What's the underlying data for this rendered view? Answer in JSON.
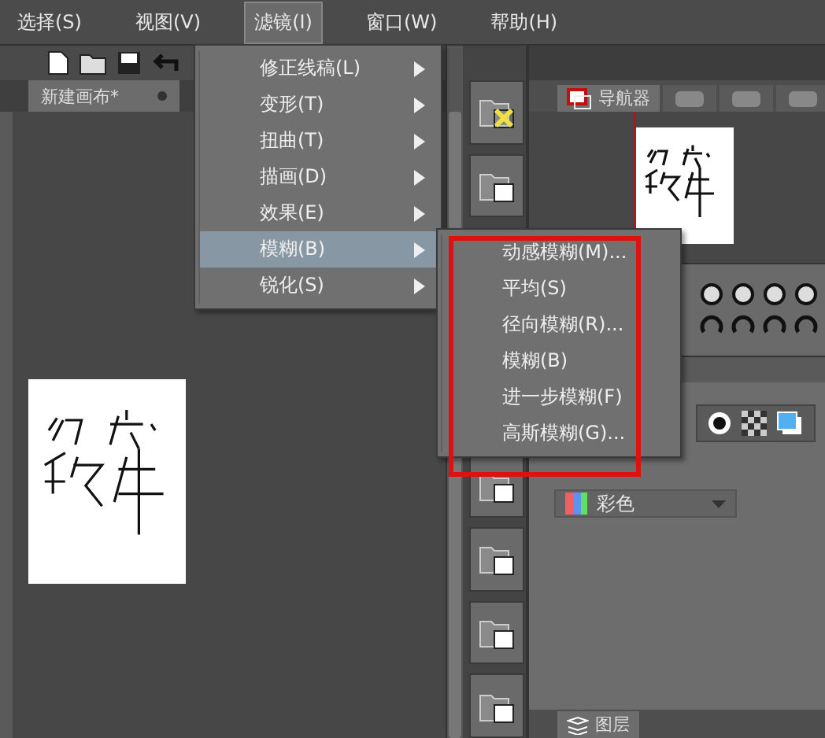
{
  "menu_bar": [
    {
      "label": "选择(S)",
      "selected": false
    },
    {
      "label": "视图(V)",
      "selected": false
    },
    {
      "label": "滤镜(I)",
      "selected": true
    },
    {
      "label": "窗口(W)",
      "selected": false
    },
    {
      "label": "帮助(H)",
      "selected": false
    }
  ],
  "document_tab": {
    "title": "新建画布*"
  },
  "filter_menu": {
    "items": [
      {
        "label": "修正线稿(L)",
        "selected": false
      },
      {
        "label": "变形(T)",
        "selected": false
      },
      {
        "label": "扭曲(T)",
        "selected": false
      },
      {
        "label": "描画(D)",
        "selected": false
      },
      {
        "label": "效果(E)",
        "selected": false
      },
      {
        "label": "模糊(B)",
        "selected": true
      },
      {
        "label": "锐化(S)",
        "selected": false
      }
    ]
  },
  "blur_submenu": {
    "items": [
      {
        "label": "动感模糊(M)..."
      },
      {
        "label": "平均(S)"
      },
      {
        "label": "径向模糊(R)..."
      },
      {
        "label": "模糊(B)"
      },
      {
        "label": "进一步模糊(F)"
      },
      {
        "label": "高斯模糊(G)..."
      }
    ]
  },
  "navigator_tab": {
    "label": "导航器"
  },
  "color_panel": {
    "mode": "彩色"
  },
  "layer_tab": {
    "label": "图层"
  }
}
